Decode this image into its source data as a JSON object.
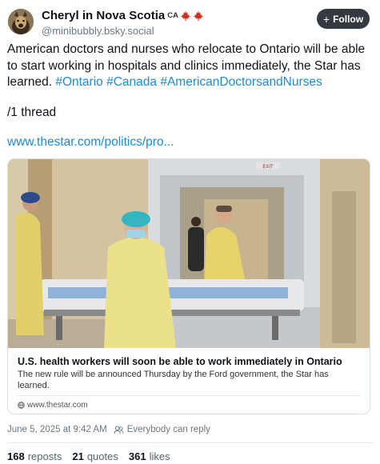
{
  "author": {
    "display_name": "Cheryl in Nova Scotia",
    "name_tag": "CA",
    "handle": "@minibubbly.bsky.social",
    "emoji_icons": [
      "maple-leaf-icon",
      "maple-leaf-icon"
    ]
  },
  "follow_button": {
    "label": "Follow",
    "icon": "plus-icon"
  },
  "post": {
    "text": "American doctors and nurses who relocate to Ontario will be able to start working in hospitals and clinics immediately, the Star has learned.",
    "hashtags": [
      "#Ontario",
      "#Canada",
      "#AmericanDoctorsandNurses"
    ],
    "thread_note": "/1 thread",
    "link": "www.thestar.com/politics/pro..."
  },
  "card": {
    "title": "U.S. health workers will soon be able to work immediately in Ontario",
    "description": "The new rule will be announced Thursday by the Ford government, the Star has learned.",
    "domain": "www.thestar.com",
    "image_signs": [
      "EXIT"
    ]
  },
  "meta": {
    "timestamp": "June 5, 2025 at 9:42 AM",
    "reply_setting": "Everybody can reply"
  },
  "stats": {
    "reposts_count": "168",
    "reposts_label": "reposts",
    "quotes_count": "21",
    "quotes_label": "quotes",
    "likes_count": "361",
    "likes_label": "likes"
  },
  "colors": {
    "accent_link": "#1d8bd8",
    "follow_button_bg": "#343a40",
    "muted_text": "#6b7785",
    "maple_leaf": "#c8321f"
  }
}
